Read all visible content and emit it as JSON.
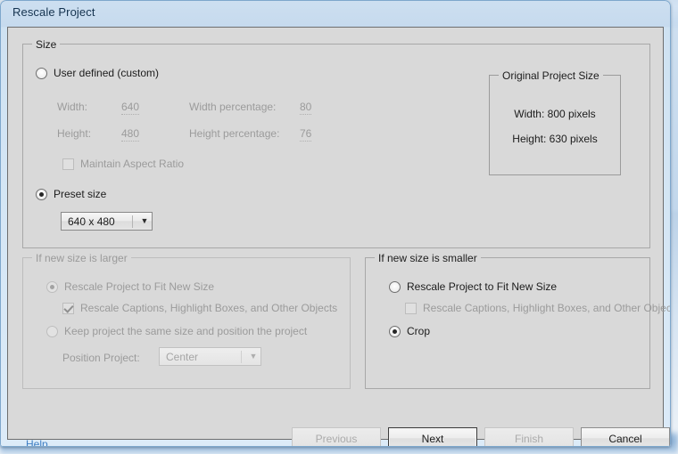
{
  "window": {
    "title": "Rescale Project"
  },
  "size_group": {
    "legend": "Size",
    "user_defined": {
      "label": "User defined (custom)",
      "selected": false,
      "enabled": true
    },
    "fields": {
      "width_label": "Width:",
      "width_value": "640",
      "height_label": "Height:",
      "height_value": "480",
      "width_pct_label": "Width percentage:",
      "width_pct_value": "80",
      "height_pct_label": "Height percentage:",
      "height_pct_value": "76"
    },
    "maintain_aspect": {
      "label": "Maintain Aspect Ratio",
      "checked": false,
      "enabled": false
    },
    "preset": {
      "label": "Preset size",
      "selected": true,
      "enabled": true,
      "dropdown_value": "640 x 480",
      "dropdown_arrow": "▼"
    }
  },
  "original_project_size": {
    "legend": "Original Project Size",
    "width_text": "Width: 800 pixels",
    "height_text": "Height: 630 pixels"
  },
  "if_larger": {
    "legend": "If new size is larger",
    "enabled": false,
    "rescale_to_fit": {
      "label": "Rescale Project to Fit New Size",
      "selected": true
    },
    "rescale_objects": {
      "label": "Rescale Captions, Highlight Boxes, and Other Objects",
      "checked": true
    },
    "keep_same_size": {
      "label": "Keep project the same size and position the project",
      "selected": false
    },
    "position_project_label": "Position Project:",
    "position_project_value": "Center",
    "position_project_arrow": "▼"
  },
  "if_smaller": {
    "legend": "If new size is smaller",
    "enabled": true,
    "rescale_to_fit": {
      "label": "Rescale Project to Fit New Size",
      "selected": false,
      "enabled": true
    },
    "rescale_objects": {
      "label": "Rescale Captions, Highlight Boxes, and Other Objects",
      "checked": false,
      "enabled": false
    },
    "crop": {
      "label": "Crop",
      "selected": true,
      "enabled": true
    }
  },
  "footer": {
    "help_label": "Help...",
    "previous_label": "Previous",
    "next_label": "Next",
    "finish_label": "Finish",
    "cancel_label": "Cancel"
  },
  "colors": {
    "link": "#3f7fc4",
    "dialog_face": "#d9d9d9",
    "aero_frame": "#c6daee",
    "disabled_text": "#9b9b9b",
    "text": "#1c1c1c"
  }
}
